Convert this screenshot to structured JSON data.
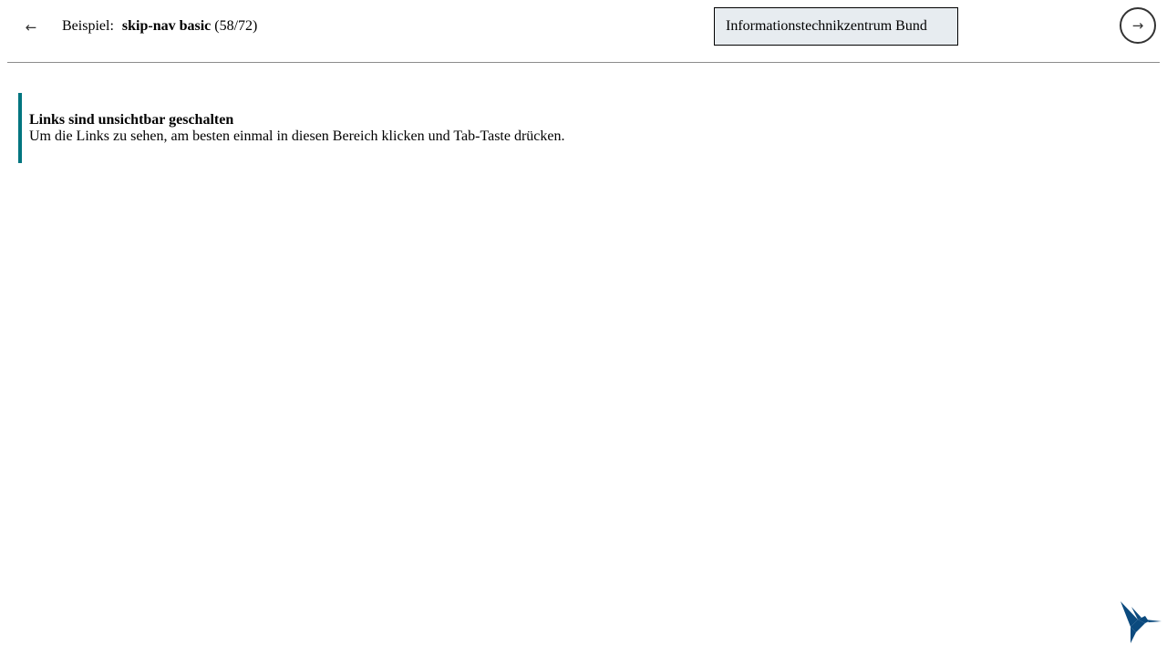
{
  "header": {
    "back_icon": "arrow-left-icon",
    "back_glyph": "←",
    "title_prefix": "Beispiel:",
    "title_name": "skip-nav basic",
    "title_count": "(58/72)",
    "organization": "Informationstechnikzentrum Bund",
    "next_icon": "arrow-right-icon",
    "next_glyph": "→"
  },
  "callout": {
    "heading": "Links sind unsichtbar geschalten",
    "text": "Um die Links zu sehen, am besten einmal in diesen Bereich klicken und Tab-Taste drücken.",
    "accent_color": "#00757f"
  },
  "logo": {
    "icon": "hummingbird-logo-icon",
    "color": "#0b4a7e"
  }
}
